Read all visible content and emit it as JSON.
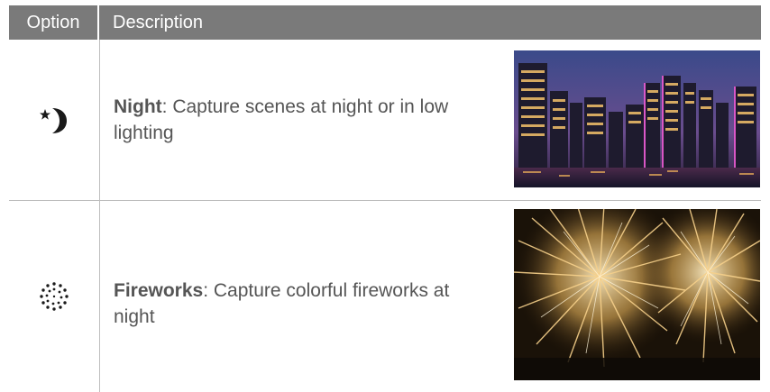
{
  "header": {
    "option_label": "Option",
    "description_label": "Description"
  },
  "rows": [
    {
      "icon": "night-mode-icon",
      "name": "Night",
      "description": ": Capture scenes at night or in low lighting",
      "image": "night-city-skyline-photo"
    },
    {
      "icon": "fireworks-mode-icon",
      "name": "Fireworks",
      "description": ": Capture colorful fireworks at night",
      "image": "fireworks-photo"
    }
  ],
  "colors": {
    "header_bg": "#7a7a7a",
    "header_text": "#ffffff",
    "body_text": "#555555",
    "divider": "#bdbdbd"
  }
}
